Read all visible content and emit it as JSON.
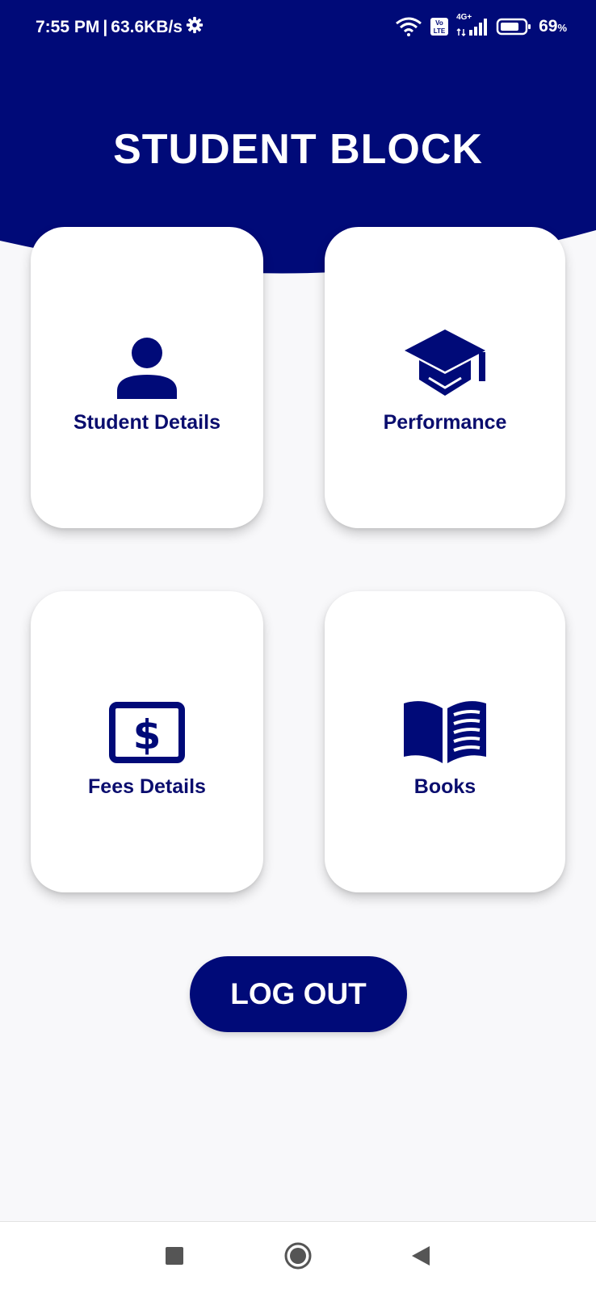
{
  "status_bar": {
    "time": "7:55 PM",
    "separator": "|",
    "net_speed": "63.6KB/s",
    "volte_label": "Vo LTE",
    "network_type": "4G+",
    "battery_value": "69",
    "battery_unit": "%"
  },
  "header": {
    "title": "STUDENT BLOCK",
    "color": "#000a78"
  },
  "menu": {
    "cards": [
      {
        "label": "Student Details",
        "icon": "person-icon"
      },
      {
        "label": "Performance",
        "icon": "graduation-cap-icon"
      },
      {
        "label": "Fees Details",
        "icon": "dollar-bill-icon"
      },
      {
        "label": "Books",
        "icon": "open-book-icon"
      }
    ]
  },
  "logout_button": {
    "label": "LOG OUT"
  },
  "nav_bar": {
    "buttons": [
      "recent-apps",
      "home",
      "back"
    ]
  },
  "colors": {
    "primary": "#000a78",
    "accent_text": "#0a0d6e",
    "background": "#f8f8fa"
  }
}
